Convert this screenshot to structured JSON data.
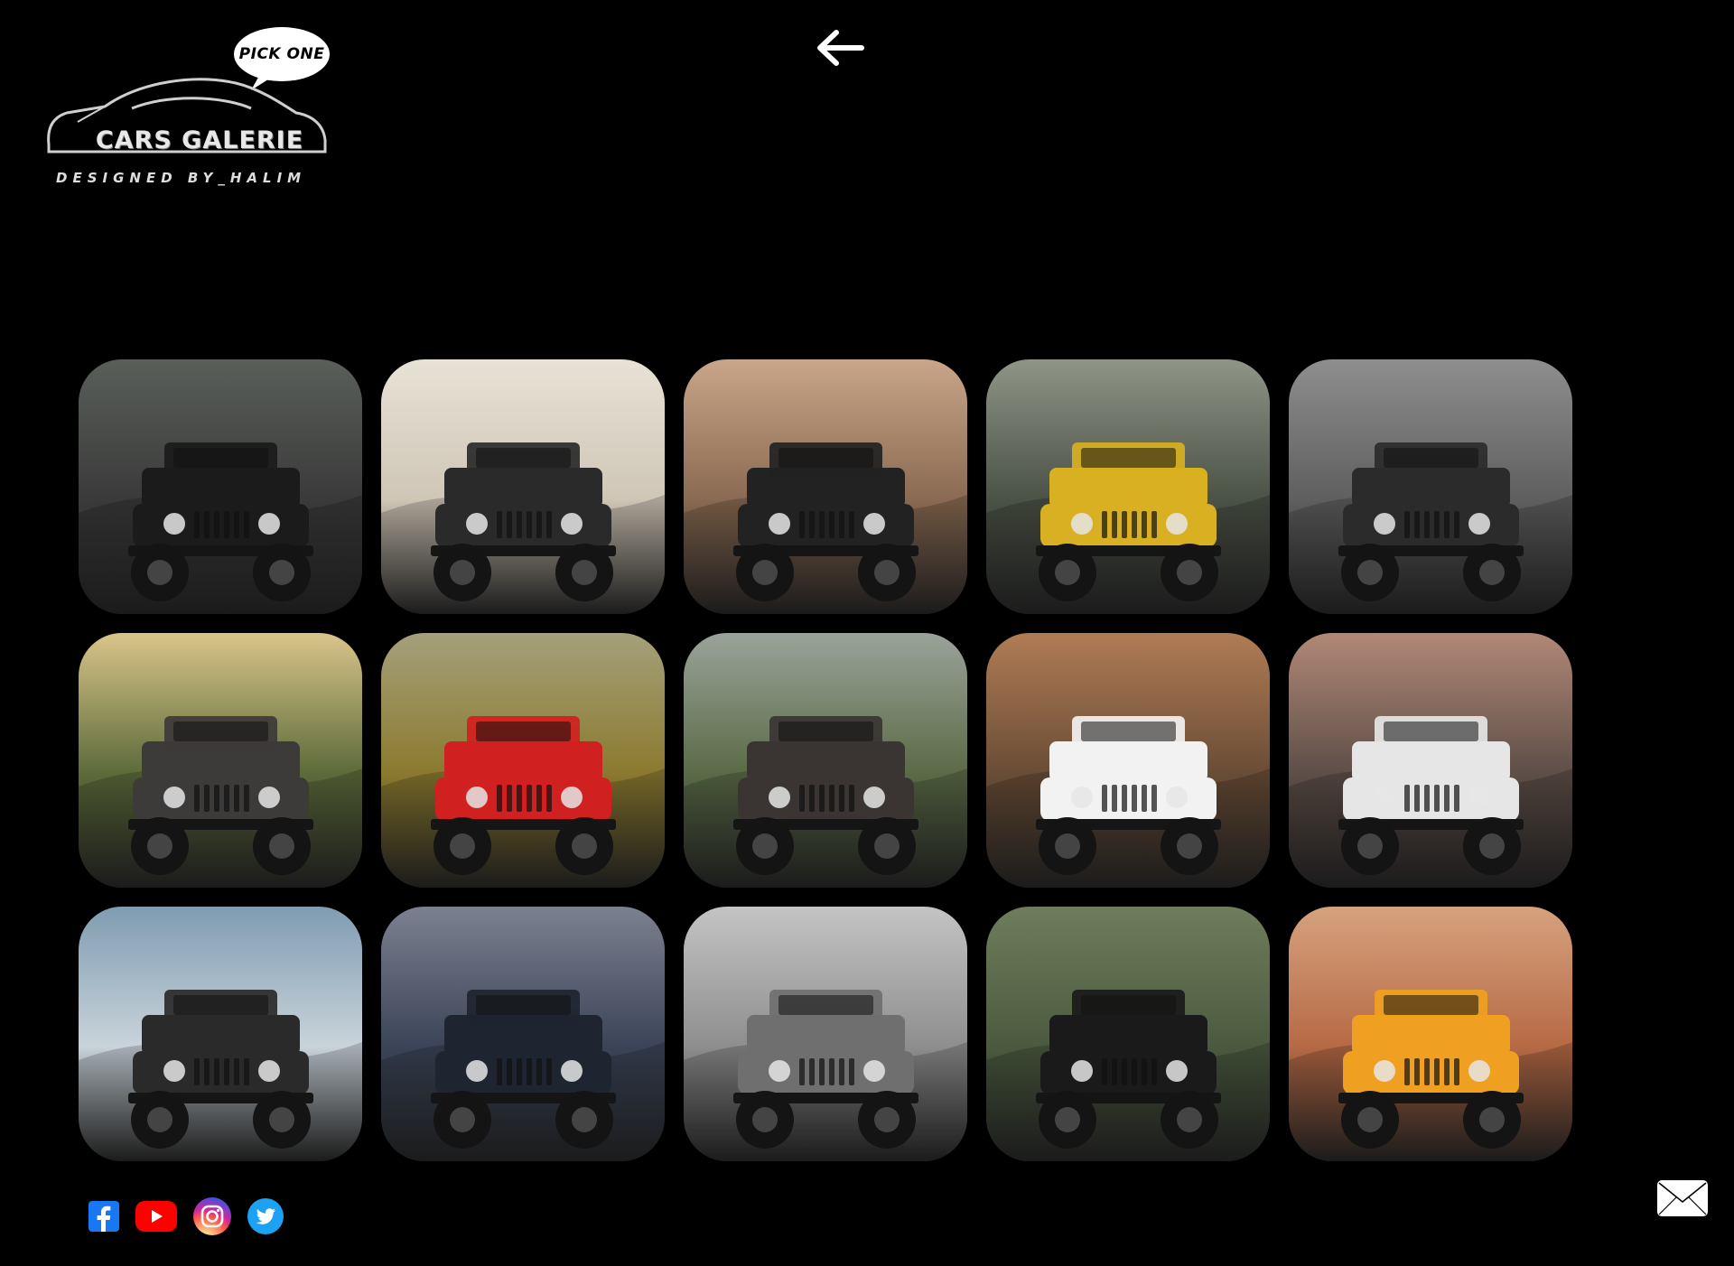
{
  "logo": {
    "bubble_text": "PICK ONE",
    "brand": "CARS GALERIE",
    "subtitle": "DESIGNED BY_HALIM"
  },
  "header": {
    "back_icon": "arrow-left-icon"
  },
  "gallery": {
    "items": [
      {
        "name": "jeep-photo-1",
        "bg": "#3a3a3a",
        "body": "#1b1b1b",
        "sky": "#5a5f5a"
      },
      {
        "name": "jeep-photo-2",
        "bg": "#cfc6b6",
        "body": "#2a2a2a",
        "sky": "#e8e2d6"
      },
      {
        "name": "jeep-photo-3",
        "bg": "#8a6a52",
        "body": "#222222",
        "sky": "#c9a689"
      },
      {
        "name": "jeep-photo-4",
        "bg": "#4b5246",
        "body": "#d8b021",
        "sky": "#8f9587"
      },
      {
        "name": "jeep-photo-5",
        "bg": "#5f5f5f",
        "body": "#2b2b2b",
        "sky": "#8e8e8e"
      },
      {
        "name": "jeep-photo-6",
        "bg": "#5d6b3a",
        "body": "#3d3a3a",
        "sky": "#d9c58a"
      },
      {
        "name": "jeep-photo-7",
        "bg": "#8b7a2f",
        "body": "#d12020",
        "sky": "#a4a07a"
      },
      {
        "name": "jeep-photo-8",
        "bg": "#5b6b47",
        "body": "#3a3532",
        "sky": "#9aa39a"
      },
      {
        "name": "jeep-photo-9",
        "bg": "#6a4d36",
        "body": "#f2f2f2",
        "sky": "#b07c55"
      },
      {
        "name": "jeep-photo-10",
        "bg": "#5e4f48",
        "body": "#e6e6e6",
        "sky": "#b28876"
      },
      {
        "name": "jeep-photo-11",
        "bg": "#c9d3da",
        "body": "#2a2a2a",
        "sky": "#7f9cb1"
      },
      {
        "name": "jeep-photo-12",
        "bg": "#3b4458",
        "body": "#1e2430",
        "sky": "#7c8190"
      },
      {
        "name": "jeep-photo-13",
        "bg": "#8e8e8e",
        "body": "#6f6f6f",
        "sky": "#c4c4c4"
      },
      {
        "name": "jeep-photo-14",
        "bg": "#4b5a3f",
        "body": "#1a1a1a",
        "sky": "#6f7d5c"
      },
      {
        "name": "jeep-photo-15",
        "bg": "#b66a45",
        "body": "#f0a020",
        "sky": "#d6a27e"
      }
    ]
  },
  "socials": [
    {
      "name": "facebook-icon",
      "glyph": "f"
    },
    {
      "name": "youtube-icon",
      "glyph": "▶"
    },
    {
      "name": "instagram-icon",
      "glyph": ""
    },
    {
      "name": "twitter-icon",
      "glyph": ""
    }
  ],
  "footer": {
    "mail_icon": "mail-icon"
  }
}
